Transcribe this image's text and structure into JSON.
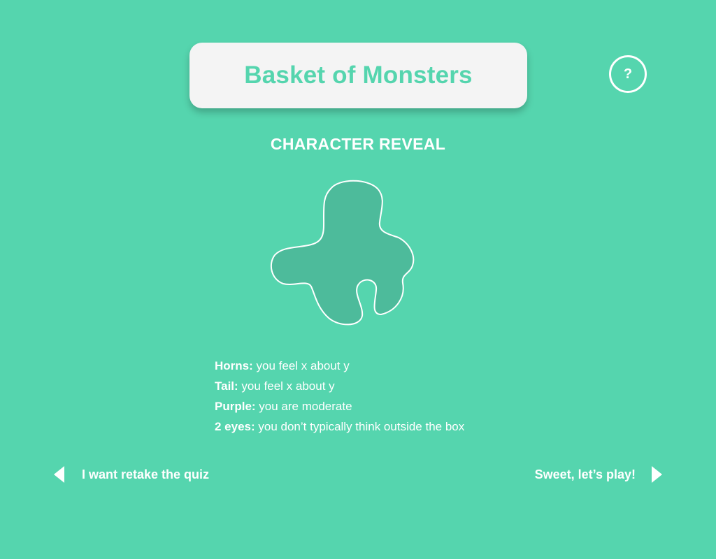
{
  "app": {
    "title": "Basket of Monsters"
  },
  "header": {
    "help_label": "?"
  },
  "reveal": {
    "heading": "CHARACTER REVEAL",
    "monster_color": "#4dbb9b",
    "monster_outline": "#ffffff"
  },
  "traits": [
    {
      "label": "Horns:",
      "desc": " you feel x about y"
    },
    {
      "label": "Tail:",
      "desc": " you feel x about y"
    },
    {
      "label": "Purple:",
      "desc": " you are moderate"
    },
    {
      "label": "2 eyes:",
      "desc": " you don’t typically think outside the box"
    }
  ],
  "nav": {
    "back_label": "I want retake the quiz",
    "back_icon": "triangle-left-icon",
    "next_label": "Sweet, let’s play!",
    "next_icon": "triangle-right-icon"
  },
  "colors": {
    "background": "#55d5ae",
    "card": "#f4f4f4",
    "accent_text": "#55d5ae"
  }
}
